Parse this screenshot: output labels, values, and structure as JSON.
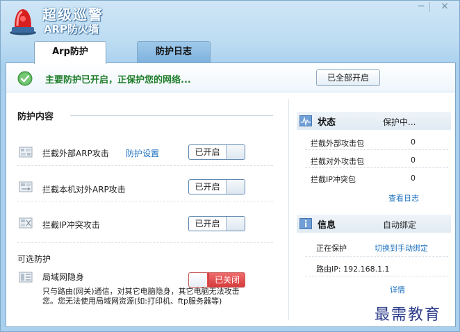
{
  "app": {
    "title": "超级巡警",
    "subtitle": "ARP防火墙"
  },
  "window_controls": {
    "minimize": "−",
    "close": "×"
  },
  "tabs": [
    {
      "label": "Arp防护",
      "active": true
    },
    {
      "label": "防护日志",
      "active": false
    }
  ],
  "status": {
    "message": "主要防护已开启，正保护您的网络...",
    "enable_all_button": "已全部开启",
    "icon": "check-circle-icon",
    "color": "#1f7d2a"
  },
  "protection": {
    "section_title": "防护内容",
    "items": [
      {
        "label": "拦截外部ARP攻击",
        "link": "防护设置",
        "toggle": "已开启",
        "icon": "shield-grid-icon"
      },
      {
        "label": "拦截本机对外ARP攻击",
        "toggle": "已开启",
        "icon": "network-out-icon"
      },
      {
        "label": "拦截IP冲突攻击",
        "toggle": "已开启",
        "icon": "ip-conflict-icon"
      }
    ],
    "optional": {
      "title": "可选防护",
      "item_label": "局域网隐身",
      "toggle": "已关闭",
      "toggle_color": "#e14b4b",
      "icon": "lan-stealth-icon",
      "description": "只与路由(网关)通信，对其它电脑隐身，其它电脑无法攻击您。您无法使用局域网资源(如:打印机、ftp服务器等)"
    }
  },
  "status_panel": {
    "title": "状态",
    "value": "保护中...",
    "icon": "activity-chart-icon",
    "rows": [
      {
        "label": "拦截外部攻击包",
        "value": "0"
      },
      {
        "label": "拦截对外攻击包",
        "value": "0"
      },
      {
        "label": "拦截IP冲突包",
        "value": "0"
      }
    ],
    "view_log_link": "查看日志"
  },
  "info_panel": {
    "title": "信息",
    "value": "自动绑定",
    "icon": "info-icon",
    "protecting_label": "正在保护",
    "switch_link": "切换到手动绑定",
    "router_ip": "路由IP: 192.168.1.1",
    "details_link": "详情"
  },
  "watermark": "最需教育"
}
